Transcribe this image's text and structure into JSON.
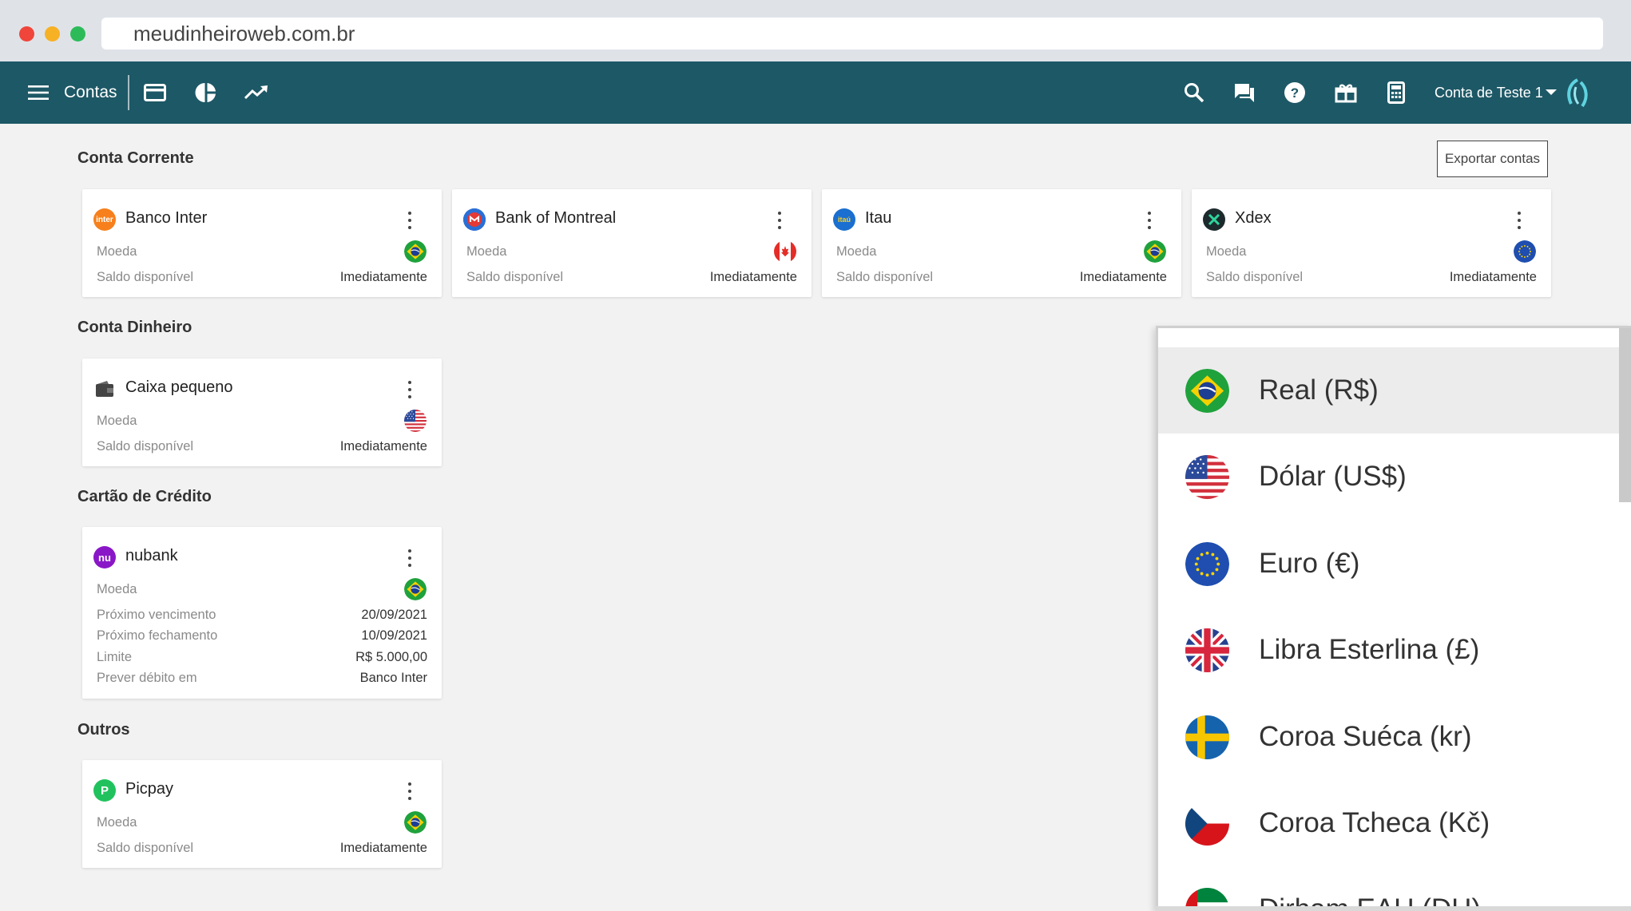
{
  "browser": {
    "url": "meudinheiroweb.com.br"
  },
  "appbar": {
    "menu_label": "Contas",
    "account_label": "Conta de Teste 1",
    "icons": [
      "menu-icon",
      "card-icon",
      "pie-chart-icon",
      "trend-icon",
      "search-icon",
      "chat-icon",
      "help-icon",
      "gift-icon",
      "calculator-icon",
      "brand-logo"
    ]
  },
  "sections": {
    "conta_corrente": "Conta Corrente",
    "conta_dinheiro": "Conta Dinheiro",
    "cartao": "Cartão de Crédito",
    "outros": "Outros"
  },
  "export_button": "Exportar contas",
  "labels": {
    "moeda": "Moeda",
    "saldo": "Saldo disponível",
    "imediatamente": "Imediatamente",
    "proximo_venc": "Próximo vencimento",
    "proximo_fech": "Próximo fechamento",
    "limite": "Limite",
    "prever": "Prever débito em"
  },
  "accounts": {
    "banco_inter": {
      "name": "Banco Inter",
      "logo_text": "inter",
      "currency": "BRL"
    },
    "montreal": {
      "name": "Bank of Montreal",
      "currency": "CAD"
    },
    "itau": {
      "name": "Itau",
      "logo_text": "itaú",
      "currency": "BRL"
    },
    "xdex": {
      "name": "Xdex",
      "currency": "EUR"
    },
    "caixa": {
      "name": "Caixa pequeno",
      "currency": "USD"
    },
    "nubank": {
      "name": "nubank",
      "logo_text": "nu",
      "currency": "BRL",
      "proximo_venc": "20/09/2021",
      "proximo_fech": "10/09/2021",
      "limite": "R$ 5.000,00",
      "prever": "Banco Inter"
    },
    "picpay": {
      "name": "Picpay",
      "logo_text": "P",
      "currency": "BRL"
    }
  },
  "currency_dropdown": {
    "selected": "Real (R$)",
    "options": [
      {
        "label": "Real (R$)",
        "flag": "brazil"
      },
      {
        "label": "Dólar (US$)",
        "flag": "usa"
      },
      {
        "label": "Euro (€)",
        "flag": "eu"
      },
      {
        "label": "Libra Esterlina (£)",
        "flag": "uk"
      },
      {
        "label": "Coroa Suéca (kr)",
        "flag": "sweden"
      },
      {
        "label": "Coroa Tcheca (Kč)",
        "flag": "czech"
      },
      {
        "label": "Dirham EAU (DH)",
        "flag": "uae"
      }
    ]
  },
  "colors": {
    "appbar": "#1d5866",
    "background": "#f2f2f2",
    "card": "#ffffff"
  }
}
